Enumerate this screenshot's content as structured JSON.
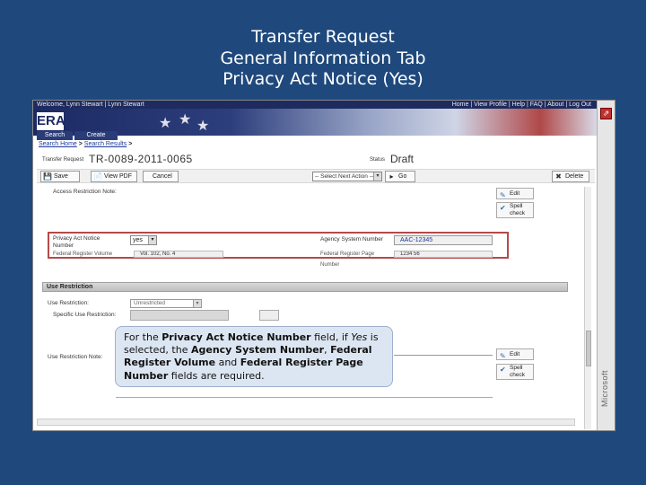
{
  "slide": {
    "title_lines": [
      "Transfer Request",
      "General Information Tab",
      "Privacy Act Notice (Yes)"
    ]
  },
  "topbar": {
    "left_text": "Welcome, Lynn Stewart | Lynn Stewart",
    "right_text": "Home | View Profile | Help | FAQ | About | Log Out"
  },
  "banner": {
    "logo_text": "ERA",
    "star_glyph": "★"
  },
  "tabs": {
    "search_label": "Search",
    "create_label": "Create"
  },
  "breadcrumb": {
    "home": "Search Home",
    "separator": " > ",
    "current": "Search Results",
    "arrow": " >"
  },
  "request": {
    "label": "Transfer Request",
    "number": "TR-0089-2011-0065",
    "status_label": "Status",
    "status_value": "Draft"
  },
  "toolbar": {
    "save_label": "Save",
    "save_icon": "💾",
    "pdf_label": "View PDF",
    "pdf_icon": "📄",
    "cancel_label": "Cancel",
    "action_placeholder": "-- Select Next Action --",
    "action_arrow": "▾",
    "go_label": "Go",
    "go_icon": "▸",
    "delete_label": "Delete",
    "delete_icon": "✖"
  },
  "form": {
    "access_label": "Access Restriction Note:",
    "edit_label": "Edit",
    "edit_icon": "✎",
    "spell_label": "Spell check",
    "spell_icon": "✔",
    "privacy_label": "Privacy Act Notice Number",
    "privacy_value": "yes",
    "select_arrow": "▾",
    "agency_label": "Agency System Number",
    "agency_value": "AAC-12345",
    "fr_volume_label": "Federal Register Volume",
    "fr_volume_value": "Vol. 102, No. 4",
    "fr_page_label": "Federal Register Page",
    "fr_page_value": "1234 56",
    "fr_page_sub": "Number"
  },
  "use_restriction": {
    "header": "Use Restriction",
    "ur_label": "Use Restriction:",
    "ur_value": "Unrestricted",
    "specific_label": "Specific Use Restriction:",
    "note_label": "Use Restriction Note:",
    "edit_label": "Edit",
    "spell_label": "Spell check"
  },
  "callout": {
    "p1": "For the ",
    "b1": "Privacy Act Notice Number",
    "p2": " field, if ",
    "i1": "Yes",
    "p3": " is selected, the ",
    "b2": "Agency System Number",
    "p4": ", ",
    "b3": "Federal Register Volume",
    "p5": " and ",
    "b4": "Federal Register Page Number",
    "p6": " fields are required."
  },
  "sidebar": {
    "brand": "Microsoft",
    "popout_icon": "⇗"
  }
}
